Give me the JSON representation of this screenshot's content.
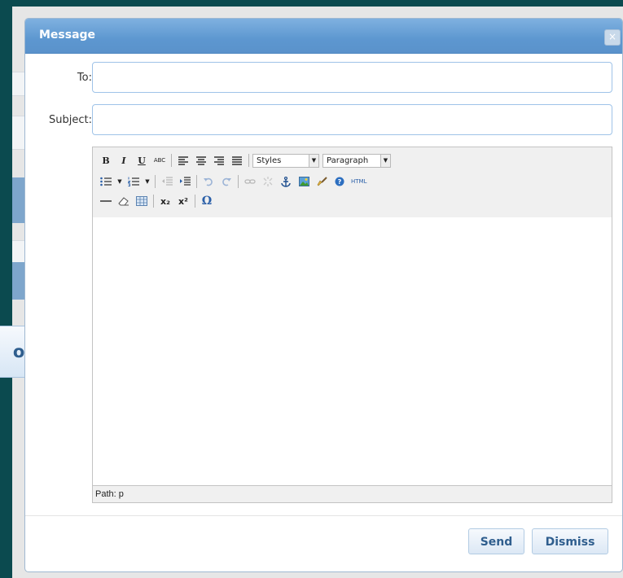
{
  "background": {
    "close_button_label": "ose"
  },
  "dialog": {
    "title": "Message",
    "close_glyph": "×",
    "to_label": "To:",
    "to_value": "",
    "subject_label": "Subject:",
    "subject_value": ""
  },
  "editor": {
    "toolbar": {
      "row1": {
        "bold": "B",
        "italic": "I",
        "underline": "U",
        "strikethrough": "ABC",
        "styles_select": "Styles",
        "format_select": "Paragraph"
      },
      "row2": {
        "html": "HTML"
      },
      "row3": {
        "subscript": "x₂",
        "superscript": "x²",
        "special_char": "Ω"
      }
    },
    "path_text": "Path: p"
  },
  "buttons": {
    "send": "Send",
    "dismiss": "Dismiss"
  },
  "colors": {
    "titlebar": "#5d97d0",
    "button_text": "#2f5e8e",
    "page_bg": "#0b4a4f"
  }
}
